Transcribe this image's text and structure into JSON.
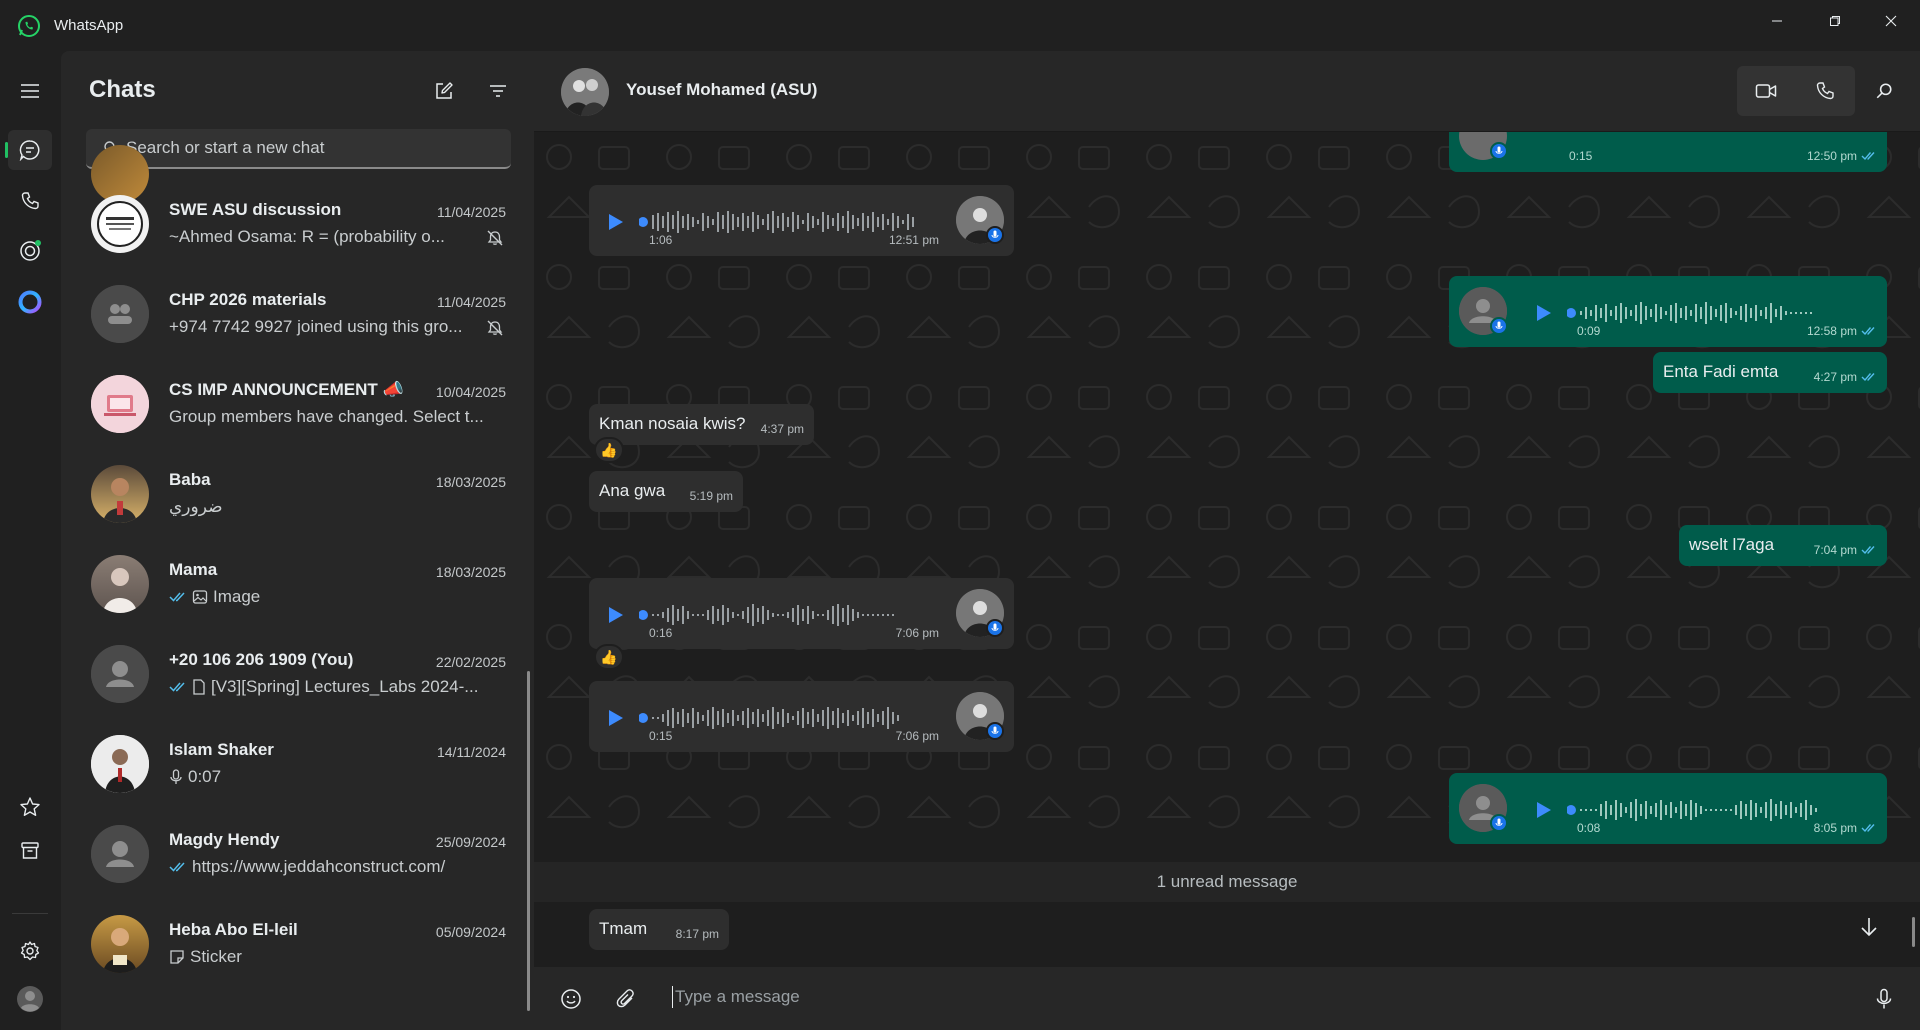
{
  "app": {
    "title": "WhatsApp"
  },
  "colors": {
    "accent": "#21c063",
    "outgoing_bubble": "#005c4b",
    "incoming_bubble": "#2e2e2e",
    "play_blue": "#3d8bfd"
  },
  "chats_panel": {
    "title": "Chats",
    "search_placeholder": "Search or start a new chat",
    "items": [
      {
        "name": "SWE ASU discussion",
        "date": "11/04/2025",
        "preview": "~Ahmed Osama: R = (probability o...",
        "preview_icon": "image-icon",
        "muted": true
      },
      {
        "name": "CHP 2026 materials",
        "date": "11/04/2025",
        "preview": "+974 7742 9927 joined using this gro...",
        "muted": true
      },
      {
        "name": "CS IMP ANNOUNCEMENT 📣",
        "date": "10/04/2025",
        "preview": "Group members have changed. Select t...",
        "muted": false
      },
      {
        "name": "Baba",
        "date": "18/03/2025",
        "preview": "ضروري",
        "muted": false
      },
      {
        "name": "Mama",
        "date": "18/03/2025",
        "preview": "Image",
        "preview_icon": "image-icon",
        "ticks": true,
        "muted": false
      },
      {
        "name": "+20 106 206 1909 (You)",
        "date": "22/02/2025",
        "preview": "[V3][Spring] Lectures_Labs 2024-...",
        "preview_icon": "document-icon",
        "ticks": true,
        "muted": false
      },
      {
        "name": "Islam Shaker",
        "date": "14/11/2024",
        "preview": "0:07",
        "preview_icon": "mic-icon",
        "muted": false
      },
      {
        "name": "Magdy Hendy",
        "date": "25/09/2024",
        "preview": "https://www.jeddahconstruct.com/",
        "ticks": true,
        "muted": false
      },
      {
        "name": "Heba Abo El-leil",
        "date": "05/09/2024",
        "preview": "Sticker",
        "preview_icon": "sticker-icon",
        "muted": false
      }
    ]
  },
  "conversation": {
    "contact_name": "Yousef Mohamed (ASU)",
    "messages": {
      "m1_time": "12:50 pm",
      "m1_dur": "0:15",
      "m2_time": "12:51 pm",
      "m2_dur": "1:06",
      "m3_time": "12:58 pm",
      "m3_dur": "0:09",
      "m4_text": "Enta Fadi emta",
      "m4_time": "4:27 pm",
      "m5_text": "Kman nosaia kwis?",
      "m5_time": "4:37 pm",
      "m6_text": "Ana gwa",
      "m6_time": "5:19 pm",
      "m7_text": "wselt l7aga",
      "m7_time": "7:04 pm",
      "m8_time": "7:06 pm",
      "m8_dur": "0:16",
      "m9_time": "7:06 pm",
      "m9_dur": "0:15",
      "m10_time": "8:05 pm",
      "m10_dur": "0:08",
      "m11_text": "Tmam",
      "m11_time": "8:17 pm",
      "reaction": "👍"
    },
    "unread_label": "1 unread message",
    "composer_placeholder": "Type a message"
  }
}
